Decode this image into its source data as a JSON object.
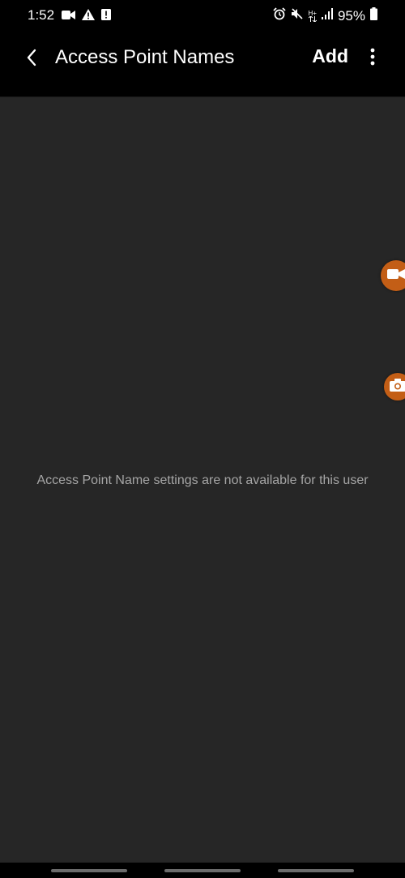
{
  "status_bar": {
    "time": "1:52",
    "left_icons": [
      "video-camera-icon",
      "warning-icon",
      "alert-icon"
    ],
    "right_icons": [
      "alarm-icon",
      "mute-icon",
      "network-h-plus-icon",
      "signal-icon",
      "battery-icon"
    ],
    "network_type": "H+",
    "battery_percent": "95%"
  },
  "app_bar": {
    "back_icon": "chevron-left-icon",
    "title": "Access Point Names",
    "add_label": "Add",
    "more_icon": "more-vertical-icon"
  },
  "content": {
    "message": "Access Point Name settings are not available for this user"
  },
  "floating_bubbles": [
    {
      "icon": "video-record-icon",
      "color": "#c35e16"
    },
    {
      "icon": "camera-icon",
      "color": "#c35e16"
    }
  ],
  "nav_bar": {
    "handles": [
      "recent-apps",
      "home",
      "back"
    ]
  },
  "colors": {
    "background": "#262626",
    "bar_background": "#000000",
    "text_primary": "#ffffff",
    "text_secondary": "#a5a5a5",
    "accent": "#c35e16"
  }
}
